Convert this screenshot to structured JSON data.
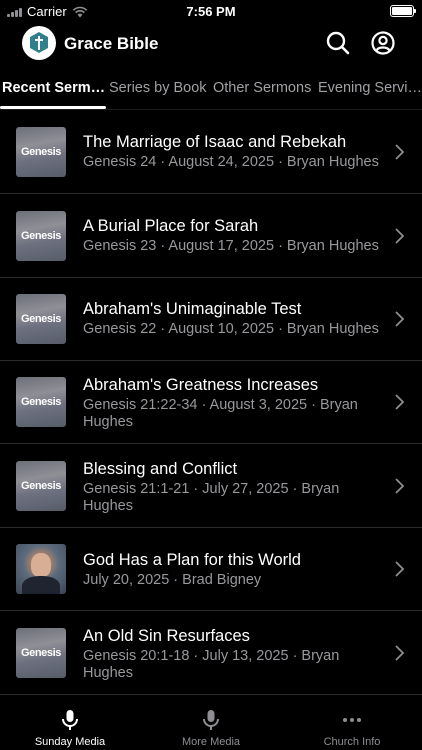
{
  "status_bar": {
    "carrier": "Carrier",
    "time": "7:56 PM"
  },
  "header": {
    "logo_text": "GRACE",
    "title": "Grace Bible",
    "search_icon": "search-icon",
    "account_icon": "account-icon"
  },
  "tabs": [
    {
      "label": "Recent Serm…",
      "active": true
    },
    {
      "label": "Series by Book",
      "active": false
    },
    {
      "label": "Other Sermons",
      "active": false
    },
    {
      "label": "Evening Servi…",
      "active": false
    }
  ],
  "sermons": [
    {
      "title": "The Marriage of Isaac and Rebekah",
      "meta": "Genesis 24 · August 24, 2025 · Bryan Hughes",
      "thumb": "Genesis"
    },
    {
      "title": "A Burial Place for Sarah",
      "meta": "Genesis 23 · August 17, 2025 · Bryan Hughes",
      "thumb": "Genesis"
    },
    {
      "title": "Abraham's Unimaginable Test",
      "meta": "Genesis 22 · August 10, 2025 · Bryan Hughes",
      "thumb": "Genesis"
    },
    {
      "title": "Abraham's Greatness Increases",
      "meta": "Genesis 21:22-34 · August 3, 2025 · Bryan Hughes",
      "thumb": "Genesis"
    },
    {
      "title": "Blessing and Conflict",
      "meta": "Genesis 21:1-21 · July 27, 2025 · Bryan Hughes",
      "thumb": "Genesis"
    },
    {
      "title": "God Has a Plan for this World",
      "meta": "July 20, 2025 · Brad Bigney",
      "thumb": ""
    },
    {
      "title": "An Old Sin Resurfaces",
      "meta": "Genesis 20:1-18 · July 13, 2025 · Bryan Hughes",
      "thumb": "Genesis"
    }
  ],
  "tab_bar": [
    {
      "label": "Sunday Media",
      "icon": "microphone-icon",
      "active": true
    },
    {
      "label": "More Media",
      "icon": "microphone-icon",
      "active": false
    },
    {
      "label": "Church Info",
      "icon": "more-dots-icon",
      "active": false
    }
  ],
  "colors": {
    "background": "#000000",
    "text": "#ffffff",
    "secondary_text": "#98989d",
    "separator": "#2c2c2e"
  }
}
